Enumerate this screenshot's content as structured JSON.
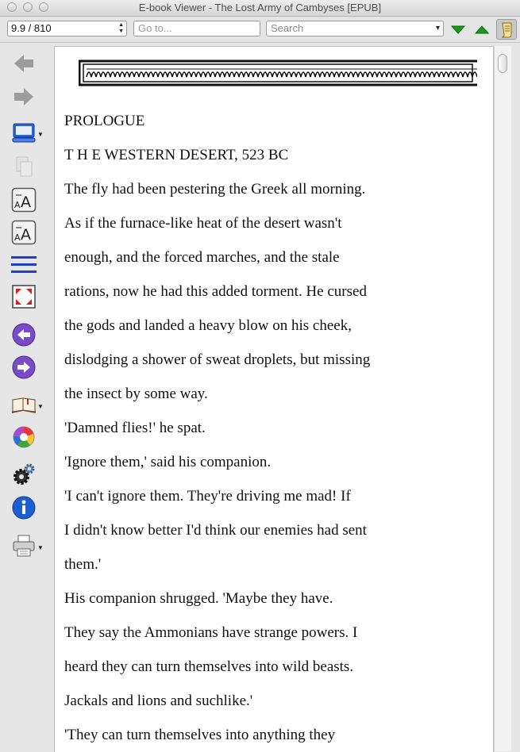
{
  "window": {
    "title": "E-book Viewer - The Lost Army of Cambyses [EPUB]"
  },
  "toolbar": {
    "position_value": "9.9 / 810",
    "goto_placeholder": "Go to...",
    "search_placeholder": "Search",
    "search_next_icon": "green-down-arrow-icon",
    "search_prev_icon": "green-up-arrow-icon",
    "toc_icon": "scroll-icon"
  },
  "sidebar": {
    "items": [
      {
        "name": "back",
        "icon": "back-arrow-icon"
      },
      {
        "name": "forward",
        "icon": "forward-arrow-icon"
      },
      {
        "name": "view",
        "icon": "monitor-icon"
      },
      {
        "name": "copy",
        "icon": "copy-icon"
      },
      {
        "name": "font-larger",
        "icon": "font-larger-icon"
      },
      {
        "name": "font-smaller",
        "icon": "font-smaller-icon"
      },
      {
        "name": "toc",
        "icon": "toc-lines-icon"
      },
      {
        "name": "fullscreen",
        "icon": "fullscreen-icon"
      },
      {
        "name": "previous-page",
        "icon": "previous-page-icon"
      },
      {
        "name": "next-page",
        "icon": "next-page-icon"
      },
      {
        "name": "bookmarks",
        "icon": "book-icon"
      },
      {
        "name": "reference",
        "icon": "reference-icon"
      },
      {
        "name": "preferences",
        "icon": "gears-icon"
      },
      {
        "name": "metadata",
        "icon": "info-icon"
      },
      {
        "name": "print",
        "icon": "printer-icon"
      }
    ],
    "accent_purple": "#7a4bc6",
    "accent_blue": "#1f3fc4"
  },
  "book": {
    "lines": [
      "PROLOGUE",
      "T H E WESTERN DESERT, 523 BC",
      "The fly had been pestering the Greek all morning.",
      "As if the furnace-like heat of the desert wasn't",
      "enough, and the forced marches, and the stale",
      "rations, now he had this added torment. He cursed",
      "the gods and landed a heavy blow on his cheek,",
      "dislodging a shower of sweat droplets, but missing",
      "the insect by some way.",
      "'Damned flies!' he spat.",
      "'Ignore them,' said his companion.",
      "'I can't ignore them. They're driving me mad! If",
      "I didn't know better I'd think our enemies had sent",
      "them.'",
      "His companion shrugged. 'Maybe they have.",
      "They say the Ammonians have strange powers. I",
      "heard they can turn themselves into wild beasts.",
      "Jackals and lions and suchlike.'",
      "'They can turn themselves into anything they"
    ]
  }
}
